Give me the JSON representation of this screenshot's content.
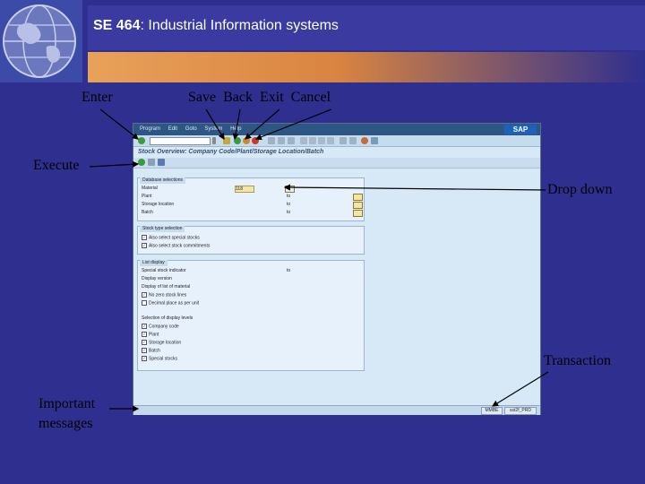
{
  "header": {
    "course_code": "SE 464",
    "course_title": ": Industrial Information systems"
  },
  "callouts": {
    "enter": "Enter",
    "save_back_exit_cancel": "Save  Back  Exit  Cancel",
    "execute": "Execute",
    "drop_down": "Drop down",
    "transaction": "Transaction",
    "important_messages_1": "Important",
    "important_messages_2": "messages"
  },
  "sap": {
    "menu": [
      "Program",
      "Edit",
      "Goto",
      "System",
      "Help"
    ],
    "logo": "SAP",
    "title": "Stock Overview: Company Code/Plant/Storage Location/Batch",
    "groups": {
      "database": {
        "title": "Database selections",
        "rows": [
          "Material",
          "Plant",
          "Storage location",
          "Batch"
        ],
        "material_value": "118",
        "to_labels": [
          "to",
          "to",
          "to",
          "to"
        ]
      },
      "stock_type": {
        "title": "Stock type selection",
        "rows": [
          "Also select special stocks",
          "Also select stock commitments"
        ]
      },
      "display": {
        "title": "List display",
        "rows": [
          "Special stock indicator",
          "Display version",
          "Display of list of material",
          "No zero stock lines",
          "Decimal place as per unit",
          "Selection of display levels",
          "Company code",
          "Plant",
          "Storage location",
          "Batch",
          "Special stocks"
        ],
        "to_label": "to"
      }
    },
    "status": {
      "transaction": "MMBE",
      "server": "sst2f_PRD"
    }
  },
  "colors": {
    "background": "#2e2f8f",
    "sap_menubar": "#2d5684",
    "sap_body": "#d7e9f7"
  }
}
